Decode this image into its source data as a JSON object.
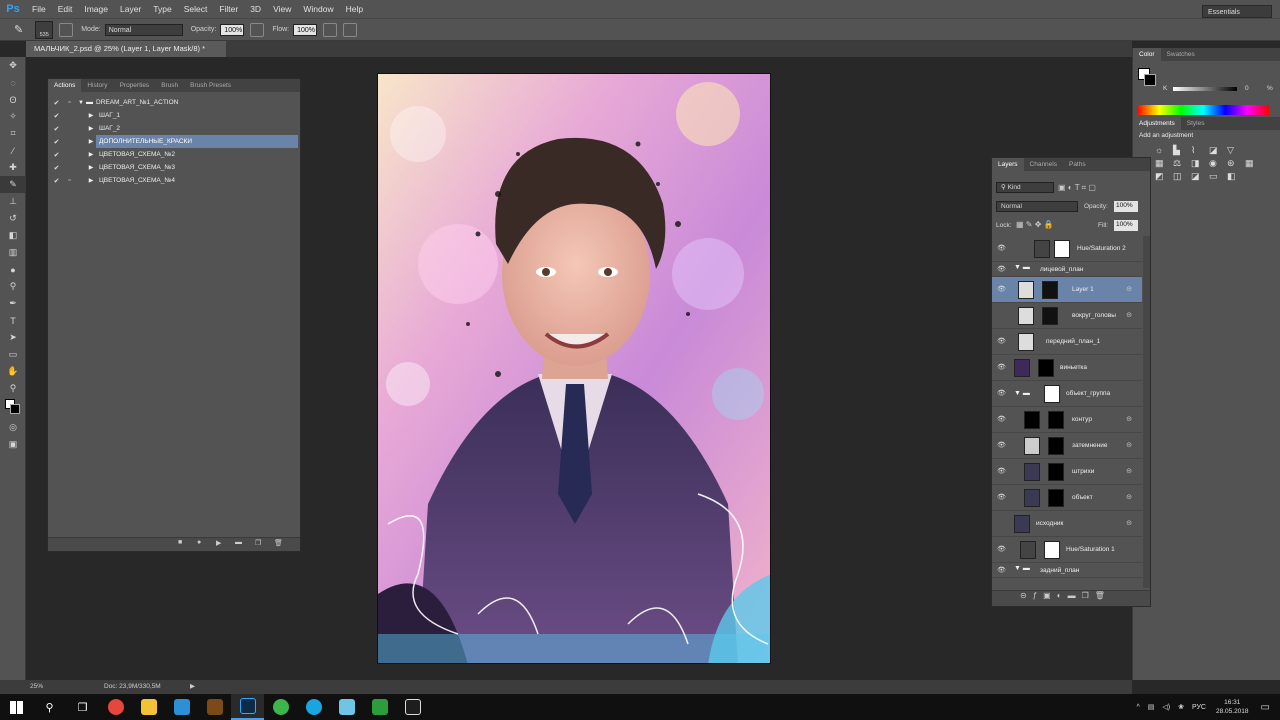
{
  "app": {
    "logo": "Ps"
  },
  "menu": [
    "File",
    "Edit",
    "Image",
    "Layer",
    "Type",
    "Select",
    "Filter",
    "3D",
    "View",
    "Window",
    "Help"
  ],
  "window_controls": [
    "–",
    "❐",
    "✕"
  ],
  "options": {
    "brush_size": "535",
    "mode_label": "Mode:",
    "mode_value": "Normal",
    "opacity_label": "Opacity:",
    "opacity_value": "100%",
    "flow_label": "Flow:",
    "flow_value": "100%",
    "workspace": "Essentials"
  },
  "document_tab": "МАЛЬЧИК_2.psd @ 25% (Layer 1, Layer Mask/8) *",
  "actions_panel": {
    "tabs": [
      "Actions",
      "History",
      "Properties",
      "Brush",
      "Brush Presets"
    ],
    "items": [
      {
        "label": "DREAM_ART_№1_ACTION",
        "folder": true
      },
      {
        "label": "ШАГ_1"
      },
      {
        "label": "ШАГ_2"
      },
      {
        "label": "ДОПОЛНИТЕЛЬНЫЕ_КРАСКИ",
        "selected": true
      },
      {
        "label": "ЦВЕТОВАЯ_СХЕМА_№2"
      },
      {
        "label": "ЦВЕТОВАЯ_СХЕМА_№3"
      },
      {
        "label": "ЦВЕТОВАЯ_СХЕМА_№4"
      }
    ]
  },
  "color_panel": {
    "tabs": [
      "Color",
      "Swatches"
    ],
    "k_label": "K",
    "k_value": "0",
    "pct": "%"
  },
  "adjustments_panel": {
    "tabs": [
      "Adjustments",
      "Styles"
    ],
    "title": "Add an adjustment"
  },
  "layers_panel": {
    "tabs": [
      "Layers",
      "Channels",
      "Paths"
    ],
    "kind": "Kind",
    "blend_mode": "Normal",
    "opacity_label": "Opacity:",
    "opacity_value": "100%",
    "lock_label": "Lock:",
    "fill_label": "Fill:",
    "fill_value": "100%",
    "layers": [
      {
        "name": "Hue/Saturation 2"
      },
      {
        "name": "лицевой_план"
      },
      {
        "name": "Layer 1"
      },
      {
        "name": "вокруг_головы"
      },
      {
        "name": "передний_план_1"
      },
      {
        "name": "виньетка"
      },
      {
        "name": "объект_группа"
      },
      {
        "name": "контур"
      },
      {
        "name": "затемнение"
      },
      {
        "name": "штрихи"
      },
      {
        "name": "объект"
      },
      {
        "name": "исходник"
      },
      {
        "name": "Hue/Saturation 1"
      },
      {
        "name": "задний_план"
      }
    ]
  },
  "status": {
    "zoom": "25%",
    "doc": "Doc: 23,9M/330,5M"
  },
  "taskbar": {
    "lang": "РУС",
    "time": "16:31",
    "date": "28.05.2018"
  },
  "colors": {
    "panel": "#535353",
    "selection": "#6a83a8",
    "canvas_bg": "#282828"
  }
}
